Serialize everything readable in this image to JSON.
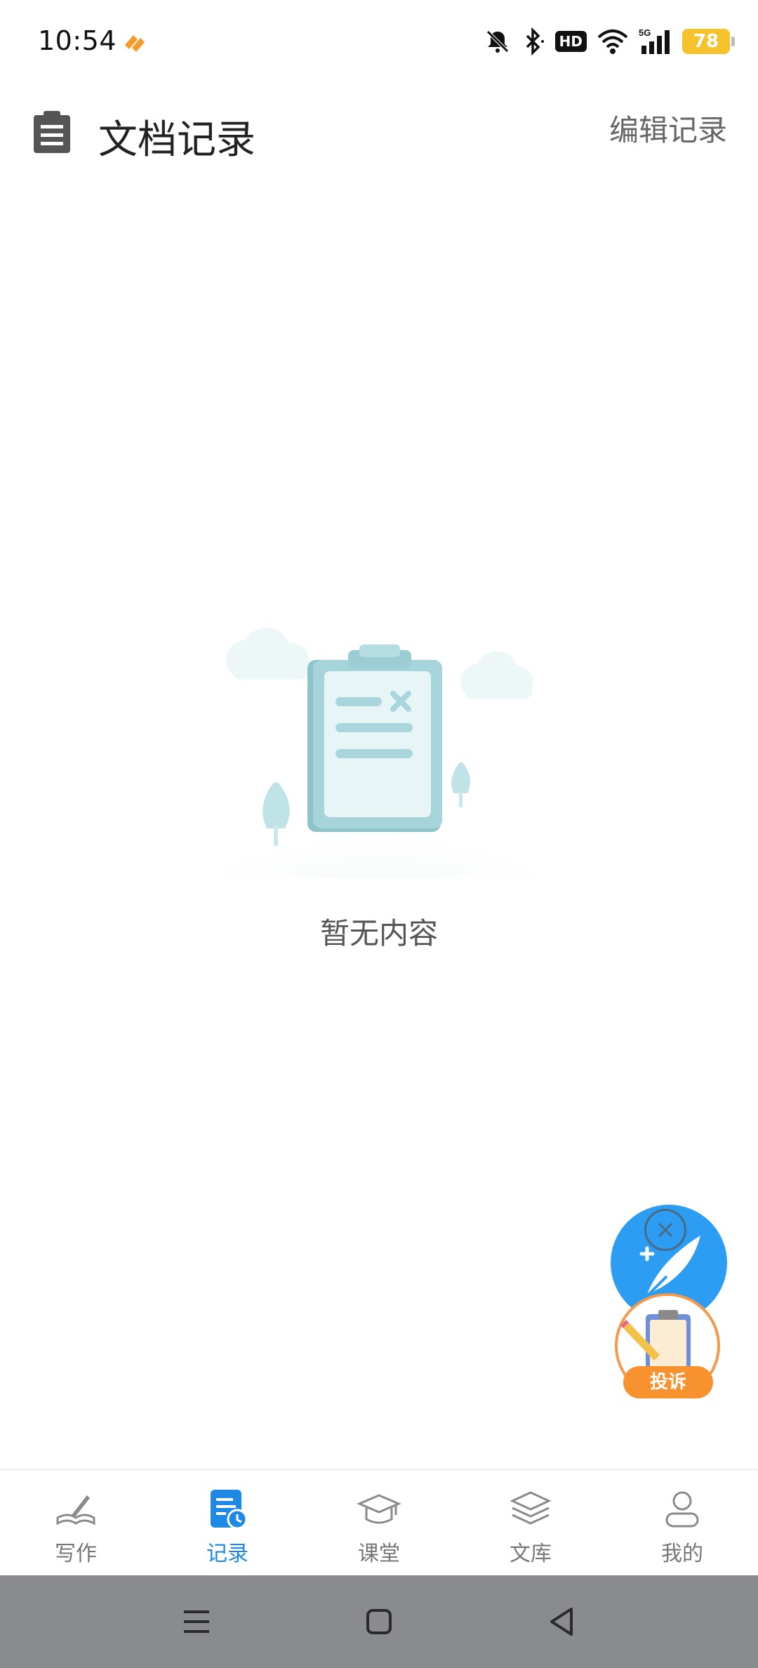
{
  "status_bar": {
    "time": "10:54",
    "battery": "78",
    "hd_label": "HD",
    "network_label": "5G"
  },
  "header": {
    "title": "文档记录",
    "edit_label": "编辑记录"
  },
  "empty_state": {
    "text": "暂无内容"
  },
  "floating": {
    "complaint_label": "投诉"
  },
  "bottom_nav": {
    "items": [
      {
        "label": "写作",
        "icon": "writing-icon"
      },
      {
        "label": "记录",
        "icon": "records-icon",
        "active": true
      },
      {
        "label": "课堂",
        "icon": "graduation-cap-icon"
      },
      {
        "label": "文库",
        "icon": "library-stack-icon"
      },
      {
        "label": "我的",
        "icon": "profile-icon"
      }
    ]
  },
  "colors": {
    "accent": "#1e88e5",
    "fab_blue": "#2d9cf3",
    "complaint_orange": "#f7922f",
    "battery": "#f5c22b"
  }
}
